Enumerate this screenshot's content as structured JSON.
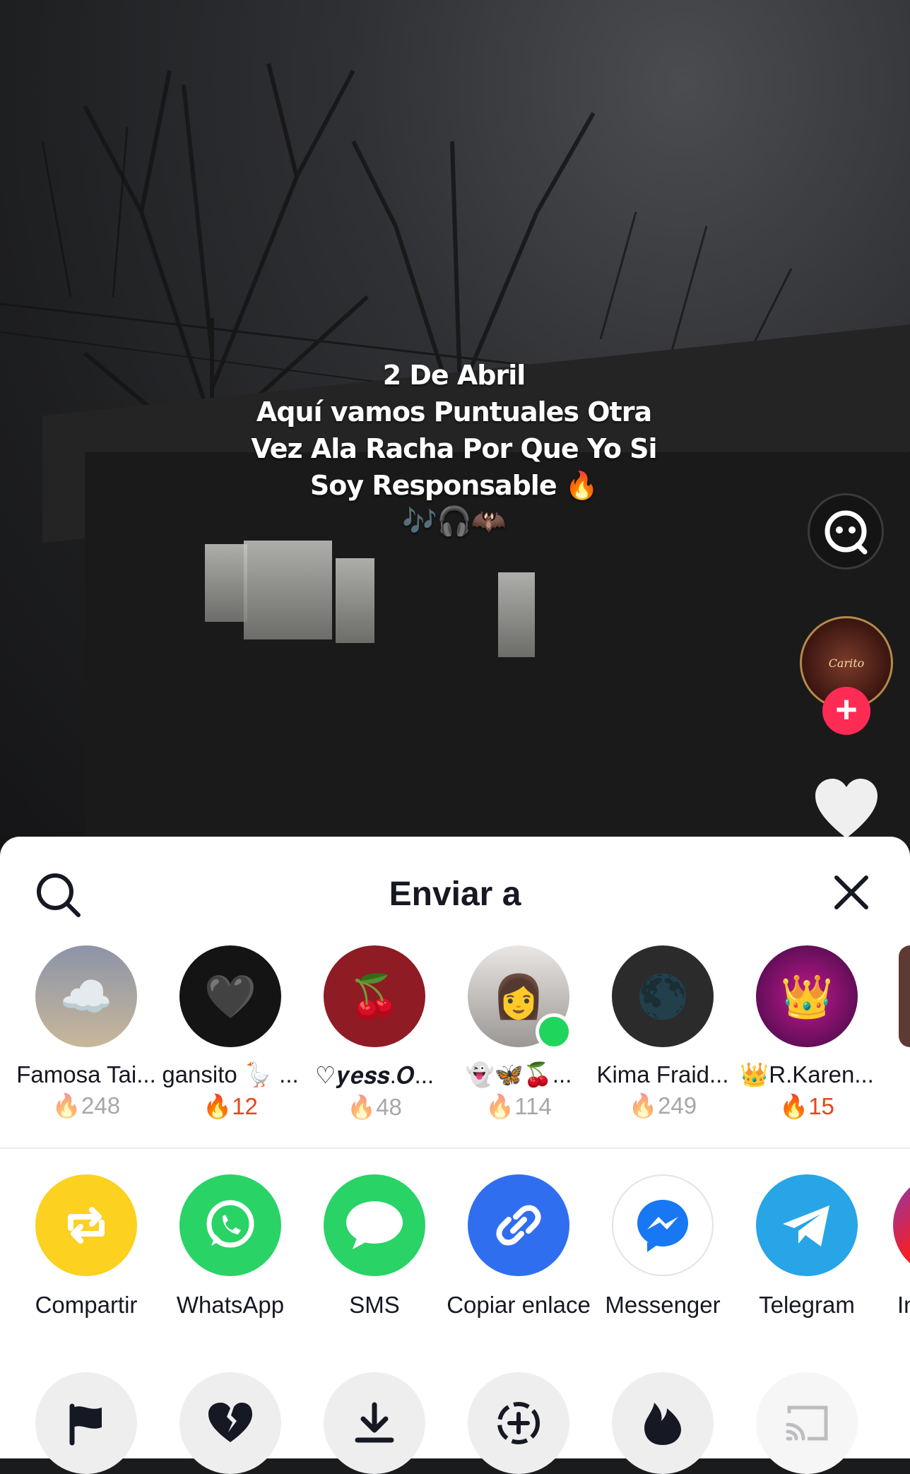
{
  "video": {
    "caption_lines": [
      "2 De Abril",
      "Aquí vamos Puntuales Otra",
      "Vez Ala Racha Por Que Yo Si",
      "Soy Responsable 🔥"
    ],
    "caption_emoji": "🎶🎧🦇",
    "creator_avatar_text": "Carito"
  },
  "sheet": {
    "title": "Enviar a",
    "contacts": [
      {
        "name": "Famosa Tai...",
        "streak": "248",
        "hot": false,
        "avatar": "☁️",
        "online": false,
        "color": "#9aa3b5"
      },
      {
        "name": "gansito 🪿 ...",
        "streak": "12",
        "hot": true,
        "avatar": "🖤",
        "online": false,
        "color": "#1b1b1b"
      },
      {
        "name": "♡𝒚𝒆𝒔𝒔.𝑶...",
        "streak": "48",
        "hot": false,
        "avatar": "🍒",
        "online": false,
        "color": "#8f1b24"
      },
      {
        "name": "👻🦋🍒...",
        "streak": "114",
        "hot": false,
        "avatar": "👩",
        "online": true,
        "color": "#c9c6c4"
      },
      {
        "name": "Kima Fraid...",
        "streak": "249",
        "hot": false,
        "avatar": "🌑",
        "online": false,
        "color": "#2b2b2b"
      },
      {
        "name": "👑R.Karen...",
        "streak": "15",
        "hot": true,
        "avatar": "👑",
        "online": false,
        "color": "#5a0e5d"
      }
    ],
    "apps": [
      {
        "label": "Compartir",
        "color": "#fcd11f",
        "icon": "repost-icon"
      },
      {
        "label": "WhatsApp",
        "color": "#29d366",
        "icon": "whatsapp-icon"
      },
      {
        "label": "SMS",
        "color": "#29d366",
        "icon": "sms-icon"
      },
      {
        "label": "Copiar enlace",
        "color": "#2f6fef",
        "icon": "link-icon"
      },
      {
        "label": "Messenger",
        "color": "#ffffff",
        "icon": "messenger-icon"
      },
      {
        "label": "Telegram",
        "color": "#27a5e6",
        "icon": "telegram-icon"
      },
      {
        "label": "In",
        "color": "#d6336c",
        "icon": "instagram-icon"
      }
    ],
    "tools": [
      "flag-icon",
      "broken-heart-icon",
      "download-icon",
      "duet-icon",
      "flame-icon",
      "cast-icon"
    ]
  }
}
